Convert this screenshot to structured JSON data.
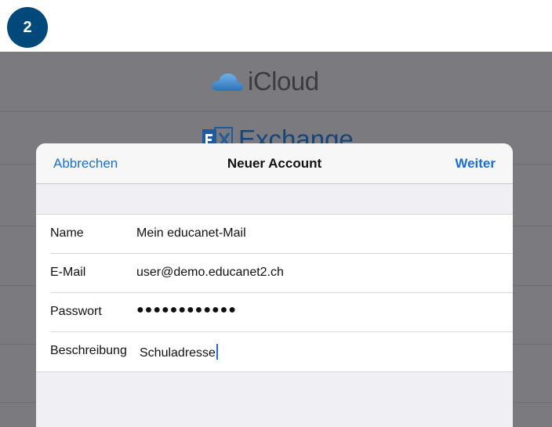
{
  "step_badge": "2",
  "background": {
    "providers": [
      {
        "name": "iCloud"
      },
      {
        "name": "Exchange"
      }
    ]
  },
  "dialog": {
    "cancel_label": "Abbrechen",
    "title": "Neuer Account",
    "next_label": "Weiter",
    "fields": [
      {
        "label": "Name",
        "value": "Mein educanet-Mail"
      },
      {
        "label": "E-Mail",
        "value": "user@demo.educanet2.ch"
      },
      {
        "label": "Passwort",
        "value": "●●●●●●●●●●●●"
      },
      {
        "label": "Beschreibung",
        "value": "Schuladresse"
      }
    ]
  },
  "colors": {
    "accent": "#1a6fd1",
    "badge": "#00497a",
    "dim_overlay": "#7b7b7f"
  }
}
